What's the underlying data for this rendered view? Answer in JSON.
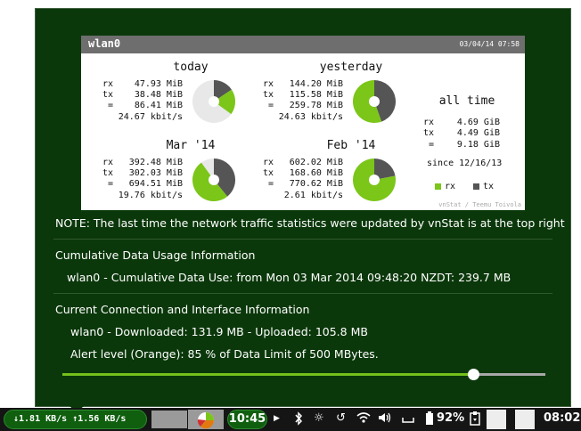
{
  "vnstat": {
    "interface": "wlan0",
    "timestamp": "03/04/14 07:58",
    "credit": "vnStat / Teemu Toivola",
    "today": {
      "title": "today",
      "rx": "47.93 MiB",
      "tx": "38.48 MiB",
      "total": "86.41 MiB",
      "rate": "24.67 kbit/s",
      "rx_share": 0.555,
      "usage_fill": 0.35
    },
    "yesterday": {
      "title": "yesterday",
      "rx": "144.20 MiB",
      "tx": "115.58 MiB",
      "total": "259.78 MiB",
      "rate": "24.63 kbit/s",
      "rx_share": 0.555,
      "usage_fill": 1.0
    },
    "month": {
      "title": "Mar '14",
      "rx": "392.48 MiB",
      "tx": "302.03 MiB",
      "total": "694.51 MiB",
      "rate": "19.76 kbit/s",
      "rx_share": 0.565,
      "usage_fill": 0.9
    },
    "prev_month": {
      "title": "Feb '14",
      "rx": "602.02 MiB",
      "tx": "168.60 MiB",
      "total": "770.62 MiB",
      "rate": "2.61 kbit/s",
      "rx_share": 0.78,
      "usage_fill": 1.0
    },
    "all_time": {
      "title": "all time",
      "rx": "4.69 GiB",
      "tx": "4.49 GiB",
      "total": "9.18 GiB",
      "since": "since 12/16/13"
    },
    "labels": {
      "rx": "rx",
      "tx": "tx",
      "eq": "="
    },
    "legend": {
      "rx": "rx",
      "tx": "tx"
    },
    "colors": {
      "rx": "#7bc618",
      "tx": "#555555",
      "unused": "#e8e8e8",
      "header": "#6e6e6e"
    }
  },
  "panel": {
    "note": "NOTE: The last time the network traffic statistics were updated by vnStat is at the top right",
    "cumulative_heading": "Cumulative Data Usage Information",
    "cumulative_line": "wlan0 - Cumulative Data Use: from Mon 03 Mar 2014 09:48:20 NZDT: 239.7 MB",
    "connection_heading": "Current Connection and Interface Information",
    "connection_line": "wlan0 - Downloaded: 131.9 MB - Uploaded: 105.8 MB",
    "alert_line": "Alert level (Orange): 85 % of Data Limit of 500 MBytes.",
    "alert_percent": 85,
    "slider_color": "#74c11c"
  },
  "taskbar": {
    "net_speed": "↓1.81 KB/s ↑1.56 KB/s",
    "clock_pill": "10:45",
    "battery": "92%",
    "time": "08:02",
    "icons": [
      "arrow-right-icon",
      "bluetooth-icon",
      "brightness-icon",
      "refresh-icon",
      "wifi-icon",
      "volume-icon",
      "keyboard-icon",
      "battery-icon",
      "clipboard-icon"
    ]
  }
}
